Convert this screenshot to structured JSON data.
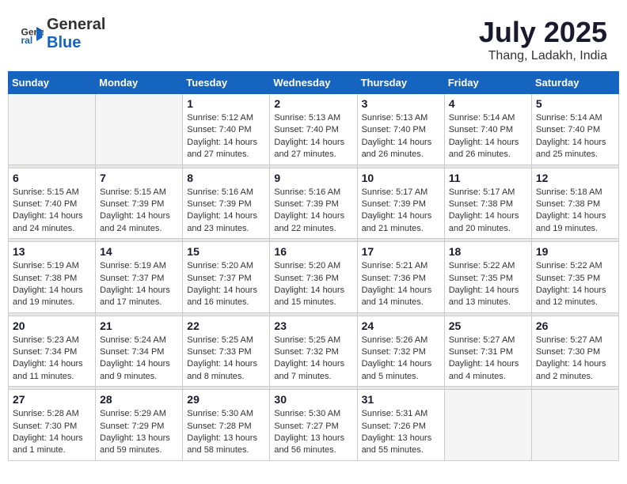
{
  "logo": {
    "text_general": "General",
    "text_blue": "Blue"
  },
  "header": {
    "month_year": "July 2025",
    "location": "Thang, Ladakh, India"
  },
  "weekdays": [
    "Sunday",
    "Monday",
    "Tuesday",
    "Wednesday",
    "Thursday",
    "Friday",
    "Saturday"
  ],
  "weeks": [
    [
      {
        "day": "",
        "info": ""
      },
      {
        "day": "",
        "info": ""
      },
      {
        "day": "1",
        "info": "Sunrise: 5:12 AM\nSunset: 7:40 PM\nDaylight: 14 hours and 27 minutes."
      },
      {
        "day": "2",
        "info": "Sunrise: 5:13 AM\nSunset: 7:40 PM\nDaylight: 14 hours and 27 minutes."
      },
      {
        "day": "3",
        "info": "Sunrise: 5:13 AM\nSunset: 7:40 PM\nDaylight: 14 hours and 26 minutes."
      },
      {
        "day": "4",
        "info": "Sunrise: 5:14 AM\nSunset: 7:40 PM\nDaylight: 14 hours and 26 minutes."
      },
      {
        "day": "5",
        "info": "Sunrise: 5:14 AM\nSunset: 7:40 PM\nDaylight: 14 hours and 25 minutes."
      }
    ],
    [
      {
        "day": "6",
        "info": "Sunrise: 5:15 AM\nSunset: 7:40 PM\nDaylight: 14 hours and 24 minutes."
      },
      {
        "day": "7",
        "info": "Sunrise: 5:15 AM\nSunset: 7:39 PM\nDaylight: 14 hours and 24 minutes."
      },
      {
        "day": "8",
        "info": "Sunrise: 5:16 AM\nSunset: 7:39 PM\nDaylight: 14 hours and 23 minutes."
      },
      {
        "day": "9",
        "info": "Sunrise: 5:16 AM\nSunset: 7:39 PM\nDaylight: 14 hours and 22 minutes."
      },
      {
        "day": "10",
        "info": "Sunrise: 5:17 AM\nSunset: 7:39 PM\nDaylight: 14 hours and 21 minutes."
      },
      {
        "day": "11",
        "info": "Sunrise: 5:17 AM\nSunset: 7:38 PM\nDaylight: 14 hours and 20 minutes."
      },
      {
        "day": "12",
        "info": "Sunrise: 5:18 AM\nSunset: 7:38 PM\nDaylight: 14 hours and 19 minutes."
      }
    ],
    [
      {
        "day": "13",
        "info": "Sunrise: 5:19 AM\nSunset: 7:38 PM\nDaylight: 14 hours and 19 minutes."
      },
      {
        "day": "14",
        "info": "Sunrise: 5:19 AM\nSunset: 7:37 PM\nDaylight: 14 hours and 17 minutes."
      },
      {
        "day": "15",
        "info": "Sunrise: 5:20 AM\nSunset: 7:37 PM\nDaylight: 14 hours and 16 minutes."
      },
      {
        "day": "16",
        "info": "Sunrise: 5:20 AM\nSunset: 7:36 PM\nDaylight: 14 hours and 15 minutes."
      },
      {
        "day": "17",
        "info": "Sunrise: 5:21 AM\nSunset: 7:36 PM\nDaylight: 14 hours and 14 minutes."
      },
      {
        "day": "18",
        "info": "Sunrise: 5:22 AM\nSunset: 7:35 PM\nDaylight: 14 hours and 13 minutes."
      },
      {
        "day": "19",
        "info": "Sunrise: 5:22 AM\nSunset: 7:35 PM\nDaylight: 14 hours and 12 minutes."
      }
    ],
    [
      {
        "day": "20",
        "info": "Sunrise: 5:23 AM\nSunset: 7:34 PM\nDaylight: 14 hours and 11 minutes."
      },
      {
        "day": "21",
        "info": "Sunrise: 5:24 AM\nSunset: 7:34 PM\nDaylight: 14 hours and 9 minutes."
      },
      {
        "day": "22",
        "info": "Sunrise: 5:25 AM\nSunset: 7:33 PM\nDaylight: 14 hours and 8 minutes."
      },
      {
        "day": "23",
        "info": "Sunrise: 5:25 AM\nSunset: 7:32 PM\nDaylight: 14 hours and 7 minutes."
      },
      {
        "day": "24",
        "info": "Sunrise: 5:26 AM\nSunset: 7:32 PM\nDaylight: 14 hours and 5 minutes."
      },
      {
        "day": "25",
        "info": "Sunrise: 5:27 AM\nSunset: 7:31 PM\nDaylight: 14 hours and 4 minutes."
      },
      {
        "day": "26",
        "info": "Sunrise: 5:27 AM\nSunset: 7:30 PM\nDaylight: 14 hours and 2 minutes."
      }
    ],
    [
      {
        "day": "27",
        "info": "Sunrise: 5:28 AM\nSunset: 7:30 PM\nDaylight: 14 hours and 1 minute."
      },
      {
        "day": "28",
        "info": "Sunrise: 5:29 AM\nSunset: 7:29 PM\nDaylight: 13 hours and 59 minutes."
      },
      {
        "day": "29",
        "info": "Sunrise: 5:30 AM\nSunset: 7:28 PM\nDaylight: 13 hours and 58 minutes."
      },
      {
        "day": "30",
        "info": "Sunrise: 5:30 AM\nSunset: 7:27 PM\nDaylight: 13 hours and 56 minutes."
      },
      {
        "day": "31",
        "info": "Sunrise: 5:31 AM\nSunset: 7:26 PM\nDaylight: 13 hours and 55 minutes."
      },
      {
        "day": "",
        "info": ""
      },
      {
        "day": "",
        "info": ""
      }
    ]
  ]
}
